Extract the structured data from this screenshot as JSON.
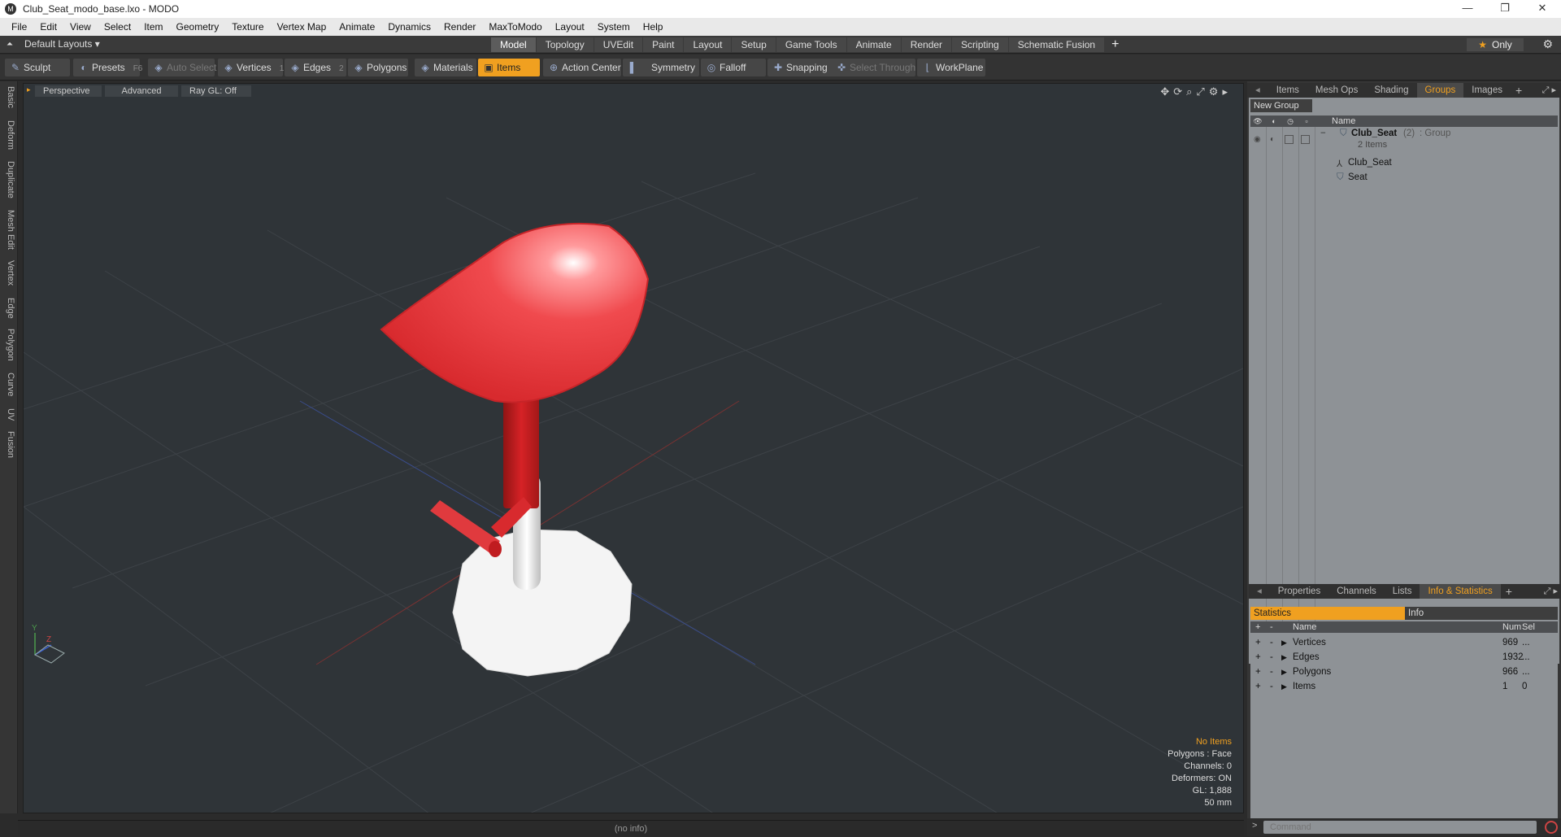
{
  "window": {
    "title": "Club_Seat_modo_base.lxo - MODO",
    "minimize": "—",
    "maximize": "❐",
    "close": "✕"
  },
  "menu": [
    "File",
    "Edit",
    "View",
    "Select",
    "Item",
    "Geometry",
    "Texture",
    "Vertex Map",
    "Animate",
    "Dynamics",
    "Render",
    "MaxToModo",
    "Layout",
    "System",
    "Help"
  ],
  "layoutbar": {
    "layout_selector": "Default Layouts ▾",
    "tabs": [
      "Model",
      "Topology",
      "UVEdit",
      "Paint",
      "Layout",
      "Setup",
      "Game Tools",
      "Animate",
      "Render",
      "Scripting",
      "Schematic Fusion"
    ],
    "active_tab": "Model",
    "plus": "+",
    "only_label": "Only"
  },
  "toolbar": {
    "sculpt": "Sculpt",
    "presets": "Presets",
    "presets_key": "F6",
    "auto_select": "Auto Select",
    "vertices": "Vertices",
    "vertices_key": "1",
    "edges": "Edges",
    "edges_key": "2",
    "polygons": "Polygons",
    "materials": "Materials",
    "items": "Items",
    "action_center": "Action Center",
    "symmetry": "Symmetry",
    "falloff": "Falloff",
    "snapping": "Snapping",
    "select_through": "Select Through",
    "workplane": "WorkPlane"
  },
  "left_tabs": [
    "Basic",
    "Deform",
    "Duplicate",
    "Mesh Edit",
    "Vertex",
    "Edge",
    "Polygon",
    "Curve",
    "UV",
    "Fusion"
  ],
  "viewport": {
    "view": "Perspective",
    "shading": "Advanced",
    "raygl": "Ray GL: Off",
    "stats": {
      "no_items": "No Items",
      "polygons": "Polygons : Face",
      "channels": "Channels: 0",
      "deformers": "Deformers: ON",
      "gl": "GL: 1,888",
      "scale": "50 mm"
    },
    "axis_y": "Y",
    "axis_z": "Z",
    "colors": {
      "seat": "#e8393d",
      "base": "#f2f2f2",
      "background": "#2f3438"
    }
  },
  "status_bar": "(no info)",
  "groups_panel": {
    "tabs": [
      "Items",
      "Mesh Ops",
      "Shading",
      "Groups",
      "Images"
    ],
    "active_tab": "Groups",
    "new_group": "New Group",
    "header_name": "Name",
    "group": {
      "name": "Club_Seat",
      "count": "(2)",
      "type": ": Group",
      "subtitle": "2 Items"
    },
    "children": [
      "Club_Seat",
      "Seat"
    ]
  },
  "stats_panel": {
    "tabs": [
      "Properties",
      "Channels",
      "Lists",
      "Info & Statistics"
    ],
    "active_tab": "Info & Statistics",
    "subtab_statistics": "Statistics",
    "subtab_info": "Info",
    "columns": {
      "plus": "+",
      "minus": "-",
      "name": "Name",
      "num": "Num",
      "sel": "Sel"
    },
    "rows": [
      {
        "name": "Vertices",
        "num": "969",
        "sel": "..."
      },
      {
        "name": "Edges",
        "num": "1932",
        "sel": "..."
      },
      {
        "name": "Polygons",
        "num": "966",
        "sel": "..."
      },
      {
        "name": "Items",
        "num": "1",
        "sel": "0"
      }
    ]
  },
  "command": {
    "placeholder": "Command"
  }
}
